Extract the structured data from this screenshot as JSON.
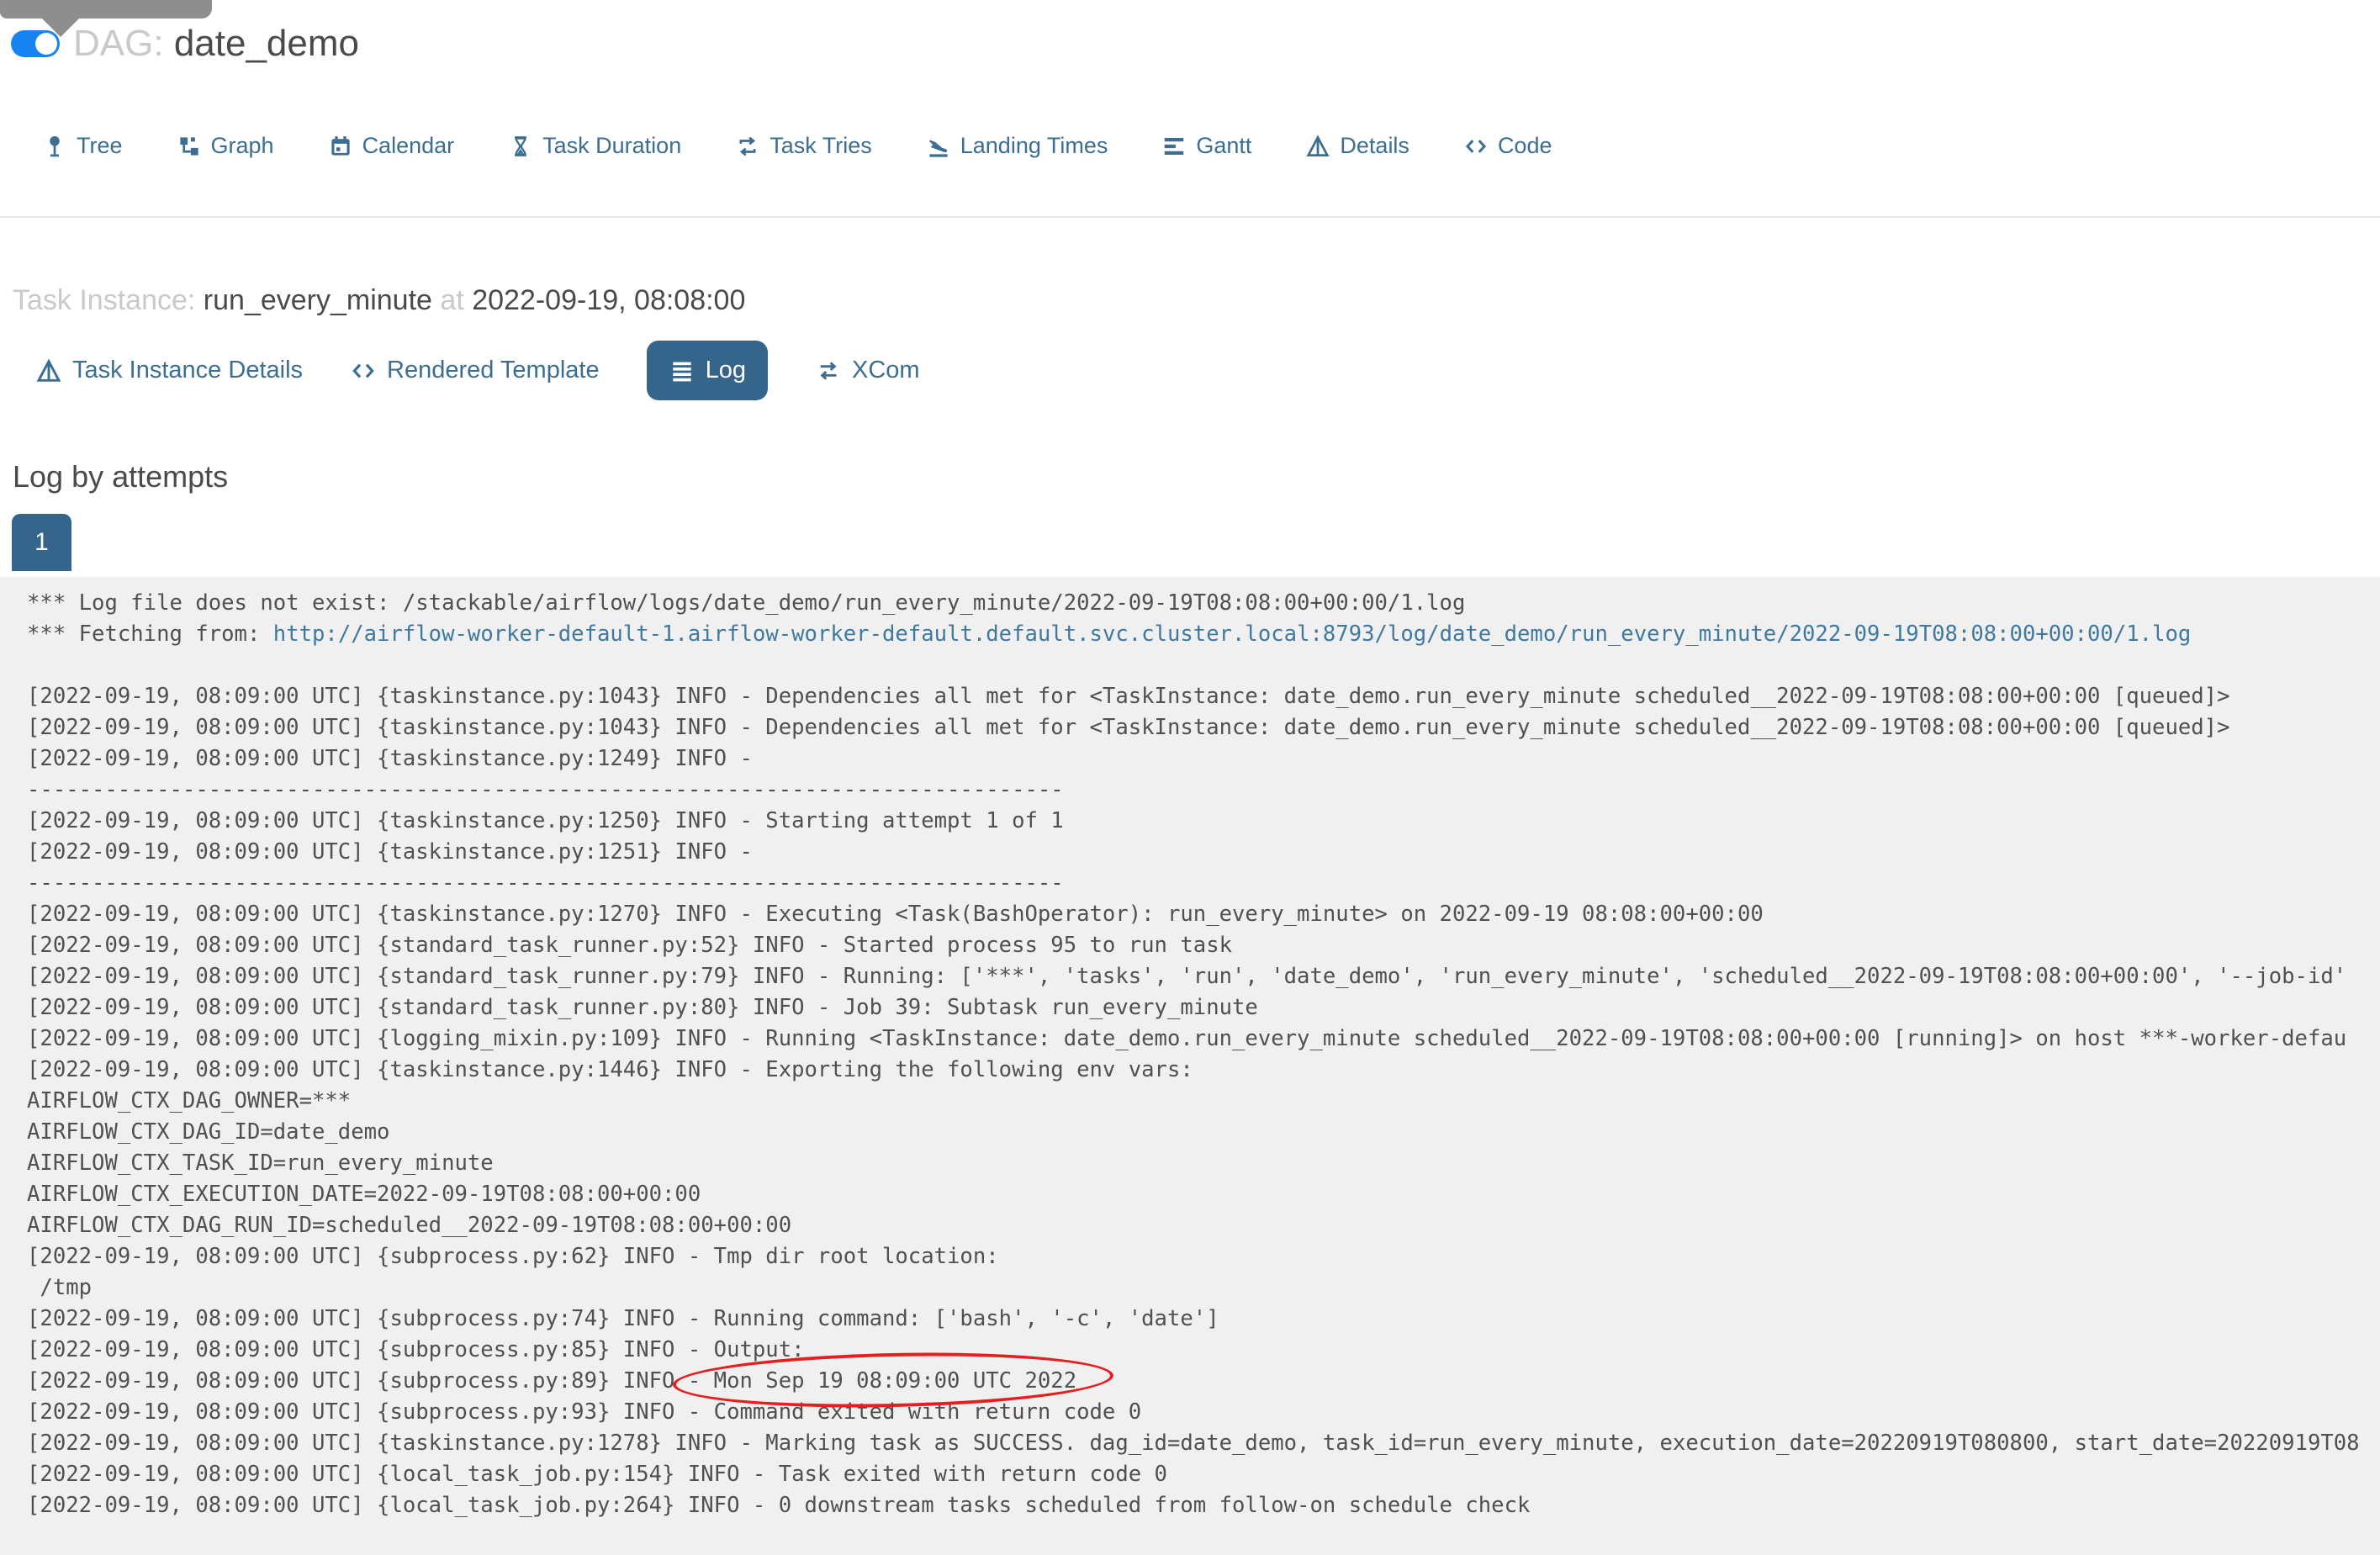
{
  "colors": {
    "accent": "#3c6e91",
    "accent_dark": "#35658a",
    "toggle_blue": "#1584f0",
    "annotation_red": "#e81d1d",
    "log_background": "#f0f0f0"
  },
  "header": {
    "dag_label": "DAG:",
    "dag_name": "date_demo"
  },
  "nav": {
    "items": [
      "Tree",
      "Graph",
      "Calendar",
      "Task Duration",
      "Task Tries",
      "Landing Times",
      "Gantt",
      "Details",
      "Code"
    ]
  },
  "task_instance": {
    "label": "Task Instance:",
    "name": "run_every_minute",
    "at": "at",
    "datetime": "2022-09-19, 08:08:00"
  },
  "sub_tabs": {
    "details": "Task Instance Details",
    "rendered": "Rendered Template",
    "log": "Log",
    "xcom": "XCom"
  },
  "log_section": {
    "heading": "Log by attempts",
    "attempt": "1",
    "lines": [
      [
        {
          "t": "*** Log file does not exist: /stackable/airflow/logs/date_demo/run_every_minute/2022-09-19T08:08:00+00:00/1.log"
        }
      ],
      [
        {
          "t": "*** Fetching from: "
        },
        {
          "t": "http://airflow-worker-default-1.airflow-worker-default.default.svc.cluster.local:8793/log/date_demo/run_every_minute/2022-09-19T08:08:00+00:00/1.log",
          "kind": "link"
        }
      ],
      [
        {
          "t": ""
        }
      ],
      [
        {
          "t": "[2022-09-19, 08:09:00 UTC] {taskinstance.py:1043} INFO - Dependencies all met for <TaskInstance: date_demo.run_every_minute scheduled__2022-09-19T08:08:00+00:00 [queued]>"
        }
      ],
      [
        {
          "t": "[2022-09-19, 08:09:00 UTC] {taskinstance.py:1043} INFO - Dependencies all met for <TaskInstance: date_demo.run_every_minute scheduled__2022-09-19T08:08:00+00:00 [queued]>"
        }
      ],
      [
        {
          "t": "[2022-09-19, 08:09:00 UTC] {taskinstance.py:1249} INFO - "
        }
      ],
      [
        {
          "t": "--------------------------------------------------------------------------------"
        }
      ],
      [
        {
          "t": "[2022-09-19, 08:09:00 UTC] {taskinstance.py:1250} INFO - Starting attempt 1 of 1"
        }
      ],
      [
        {
          "t": "[2022-09-19, 08:09:00 UTC] {taskinstance.py:1251} INFO - "
        }
      ],
      [
        {
          "t": "--------------------------------------------------------------------------------"
        }
      ],
      [
        {
          "t": "[2022-09-19, 08:09:00 UTC] {taskinstance.py:1270} INFO - Executing <Task(BashOperator): run_every_minute> on 2022-09-19 08:08:00+00:00"
        }
      ],
      [
        {
          "t": "[2022-09-19, 08:09:00 UTC] {standard_task_runner.py:52} INFO - Started process 95 to run task"
        }
      ],
      [
        {
          "t": "[2022-09-19, 08:09:00 UTC] {standard_task_runner.py:79} INFO - Running: ['***', 'tasks', 'run', 'date_demo', 'run_every_minute', 'scheduled__2022-09-19T08:08:00+00:00', '--job-id'"
        }
      ],
      [
        {
          "t": "[2022-09-19, 08:09:00 UTC] {standard_task_runner.py:80} INFO - Job 39: Subtask run_every_minute"
        }
      ],
      [
        {
          "t": "[2022-09-19, 08:09:00 UTC] {logging_mixin.py:109} INFO - Running <TaskInstance: date_demo.run_every_minute scheduled__2022-09-19T08:08:00+00:00 [running]> on host ***-worker-defau"
        }
      ],
      [
        {
          "t": "[2022-09-19, 08:09:00 UTC] {taskinstance.py:1446} INFO - Exporting the following env vars:"
        }
      ],
      [
        {
          "t": "AIRFLOW_CTX_DAG_OWNER=***"
        }
      ],
      [
        {
          "t": "AIRFLOW_CTX_DAG_ID=date_demo"
        }
      ],
      [
        {
          "t": "AIRFLOW_CTX_TASK_ID=run_every_minute"
        }
      ],
      [
        {
          "t": "AIRFLOW_CTX_EXECUTION_DATE=2022-09-19T08:08:00+00:00"
        }
      ],
      [
        {
          "t": "AIRFLOW_CTX_DAG_RUN_ID=scheduled__2022-09-19T08:08:00+00:00"
        }
      ],
      [
        {
          "t": "[2022-09-19, 08:09:00 UTC] {subprocess.py:62} INFO - Tmp dir root location: "
        }
      ],
      [
        {
          "t": " /tmp"
        }
      ],
      [
        {
          "t": "[2022-09-19, 08:09:00 UTC] {subprocess.py:74} INFO - Running command: ['bash', '-c', 'date']"
        }
      ],
      [
        {
          "t": "[2022-09-19, 08:09:00 UTC] {subprocess.py:85} INFO - Output:"
        }
      ],
      [
        {
          "t": "[2022-09-19, 08:09:00 UTC] {subprocess.py:89} INFO "
        },
        {
          "t": "- Mon Sep 19 08:09:00 UTC 2022",
          "kind": "circled"
        }
      ],
      [
        {
          "t": "[2022-09-19, 08:09:00 UTC] {subprocess.py:93} INFO - Command exited with return code 0"
        }
      ],
      [
        {
          "t": "[2022-09-19, 08:09:00 UTC] {taskinstance.py:1278} INFO - Marking task as SUCCESS. dag_id=date_demo, task_id=run_every_minute, execution_date=20220919T080800, start_date=20220919T08"
        }
      ],
      [
        {
          "t": "[2022-09-19, 08:09:00 UTC] {local_task_job.py:154} INFO - Task exited with return code 0"
        }
      ],
      [
        {
          "t": "[2022-09-19, 08:09:00 UTC] {local_task_job.py:264} INFO - 0 downstream tasks scheduled from follow-on schedule check"
        }
      ]
    ]
  }
}
